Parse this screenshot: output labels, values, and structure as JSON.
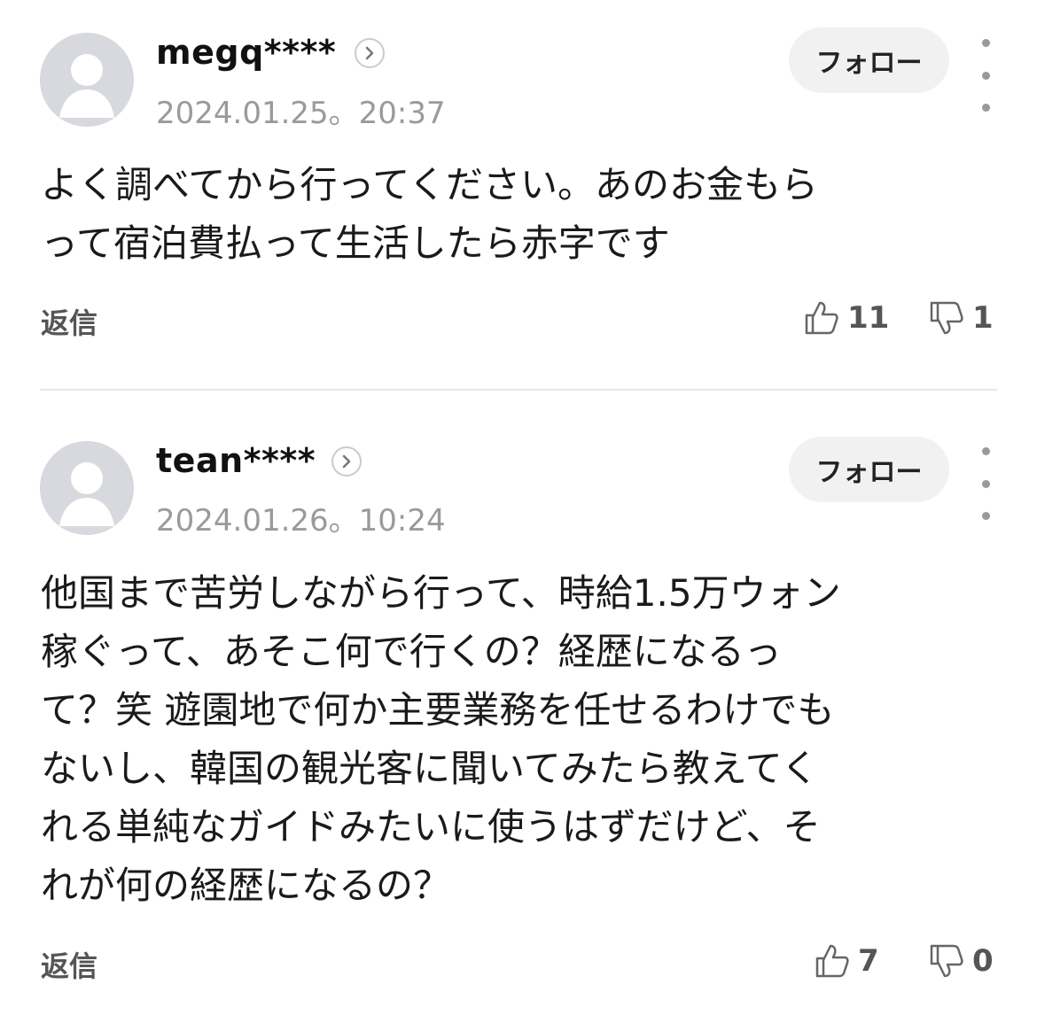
{
  "comments": [
    {
      "username": "megq****",
      "timestamp": "2024.01.25。20:37",
      "follow_label": "フォロー",
      "body": "よく調べてから行ってください。あのお金もら\nって宿泊費払って生活したら赤字です",
      "reply_label": "返信",
      "likes": "11",
      "dislikes": "1"
    },
    {
      "username": "tean****",
      "timestamp": "2024.01.26。10:24",
      "follow_label": "フォロー",
      "body": "他国まで苦労しながら行って、時給1.5万ウォン\n稼ぐって、あそこ何で行くの？経歴になるっ\nて？笑 遊園地で何か主要業務を任せるわけでも\nないし、韓国の観光客に聞いてみたら教えてく\nれる単純なガイドみたいに使うはずだけど、そ\nれが何の経歴になるの？",
      "reply_label": "返信",
      "likes": "7",
      "dislikes": "0"
    }
  ]
}
